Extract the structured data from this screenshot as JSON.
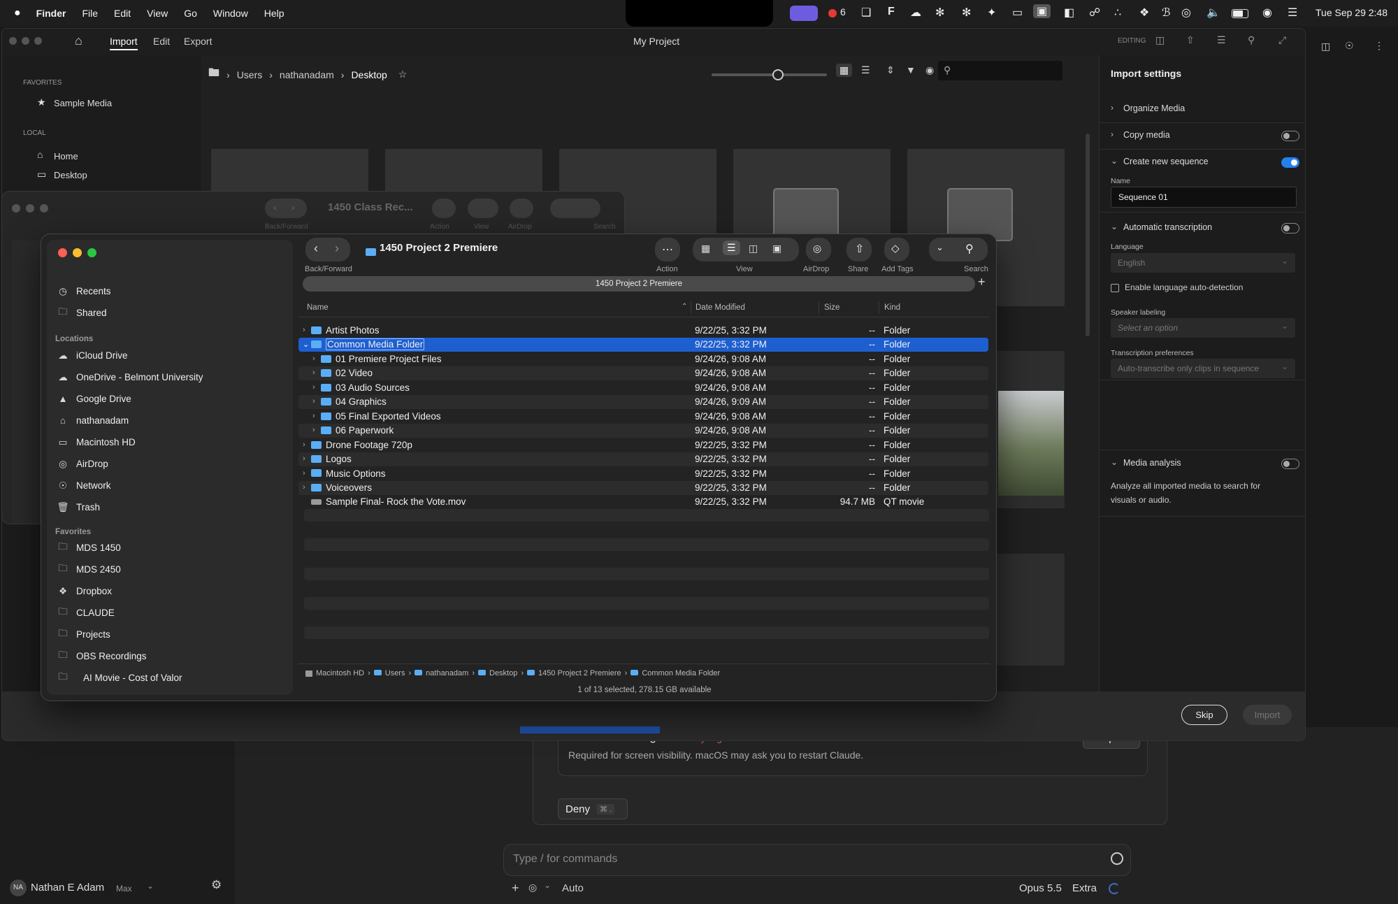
{
  "menubar": {
    "app": "Finder",
    "items": [
      "File",
      "Edit",
      "View",
      "Go",
      "Window",
      "Help"
    ],
    "record_count": "6",
    "clock": "Tue Sep 29  2:48"
  },
  "premiere": {
    "tabs": [
      "Import",
      "Edit",
      "Export"
    ],
    "title": "My Project",
    "mode": "EDITING",
    "sidebar": {
      "favorites_head": "FAVORITES",
      "favorites": [
        "Sample Media"
      ],
      "local_head": "LOCAL",
      "local": [
        "Home",
        "Desktop"
      ]
    },
    "breadcrumb": [
      "Users",
      "nathanadam",
      "Desktop"
    ],
    "settings": {
      "title": "Import settings",
      "organize": "Organize Media",
      "copy": "Copy media",
      "create_seq": "Create new sequence",
      "name_label": "Name",
      "name_value": "Sequence 01",
      "auto_trans": "Automatic transcription",
      "lang_label": "Language",
      "lang_value": "English",
      "auto_detect": "Enable language auto-detection",
      "speaker_label": "Speaker labeling",
      "speaker_placeholder": "Select an option",
      "pref_label": "Transcription preferences",
      "pref_value": "Auto-transcribe only clips in sequence",
      "media_analysis": "Media analysis",
      "media_desc": "Analyze all imported media to search for visuals or audio."
    },
    "skip": "Skip",
    "import": "Import"
  },
  "finder_back": {
    "title": "1450 Class Rec...",
    "labels": [
      "Back/Forward",
      "Action",
      "View",
      "AirDrop",
      "Search"
    ]
  },
  "finder": {
    "title": "1450 Project 2 Premiere",
    "path_tab": "1450 Project 2 Premiere",
    "toolbar": {
      "back_forward": "Back/Forward",
      "action": "Action",
      "view": "View",
      "airdrop": "AirDrop",
      "share": "Share",
      "tags": "Add Tags",
      "search": "Search"
    },
    "sidebar": {
      "top": [
        "Recents",
        "Shared"
      ],
      "locations_head": "Locations",
      "locations": [
        "iCloud Drive",
        "OneDrive - Belmont University",
        "Google Drive",
        "nathanadam",
        "Macintosh HD",
        "AirDrop",
        "Network",
        "Trash"
      ],
      "favorites_head": "Favorites",
      "favorites": [
        "MDS 1450",
        "MDS 2450",
        "Dropbox",
        "CLAUDE",
        "Projects",
        "OBS Recordings",
        "AI Movie - Cost of Valor"
      ]
    },
    "columns": {
      "name": "Name",
      "date": "Date Modified",
      "size": "Size",
      "kind": "Kind"
    },
    "rows": [
      {
        "name": "Artist Photos",
        "date": "9/22/25, 3:32 PM",
        "size": "--",
        "kind": "Folder"
      },
      {
        "name": "Common Media Folder",
        "date": "9/22/25, 3:32 PM",
        "size": "--",
        "kind": "Folder"
      },
      {
        "name": "01 Premiere Project Files",
        "date": "9/24/26, 9:08 AM",
        "size": "--",
        "kind": "Folder"
      },
      {
        "name": "02 Video",
        "date": "9/24/26, 9:08 AM",
        "size": "--",
        "kind": "Folder"
      },
      {
        "name": "03 Audio Sources",
        "date": "9/24/26, 9:08 AM",
        "size": "--",
        "kind": "Folder"
      },
      {
        "name": "04 Graphics",
        "date": "9/24/26, 9:09 AM",
        "size": "--",
        "kind": "Folder"
      },
      {
        "name": "05 Final Exported Videos",
        "date": "9/24/26, 9:08 AM",
        "size": "--",
        "kind": "Folder"
      },
      {
        "name": "06 Paperwork",
        "date": "9/24/26, 9:08 AM",
        "size": "--",
        "kind": "Folder"
      },
      {
        "name": "Drone Footage 720p",
        "date": "9/22/25, 3:32 PM",
        "size": "--",
        "kind": "Folder"
      },
      {
        "name": "Logos",
        "date": "9/22/25, 3:32 PM",
        "size": "--",
        "kind": "Folder"
      },
      {
        "name": "Music Options",
        "date": "9/22/25, 3:32 PM",
        "size": "--",
        "kind": "Folder"
      },
      {
        "name": "Voiceovers",
        "date": "9/22/25, 3:32 PM",
        "size": "--",
        "kind": "Folder"
      },
      {
        "name": "Sample Final- Rock the Vote.mov",
        "date": "9/22/25, 3:32 PM",
        "size": "94.7 MB",
        "kind": "QT movie"
      }
    ],
    "pathbar": [
      "Macintosh HD",
      "Users",
      "nathanadam",
      "Desktop",
      "1450 Project 2 Premiere",
      "Common Media Folder"
    ],
    "status": "1 of 13 selected, 278.15 GB available"
  },
  "claude": {
    "perm_title": "Screen recording",
    "perm_state": "Not yet granted",
    "perm_desc": "Required for screen visibility. macOS may ask you to restart Claude.",
    "request": "Request",
    "deny": "Deny",
    "deny_keys": "⌘ .",
    "input_placeholder": "Type / for commands",
    "auto": "Auto",
    "model": "Opus 5.5",
    "effort": "Extra",
    "user_initials": "NA",
    "user_name": "Nathan E Adam",
    "plan": "Max"
  }
}
